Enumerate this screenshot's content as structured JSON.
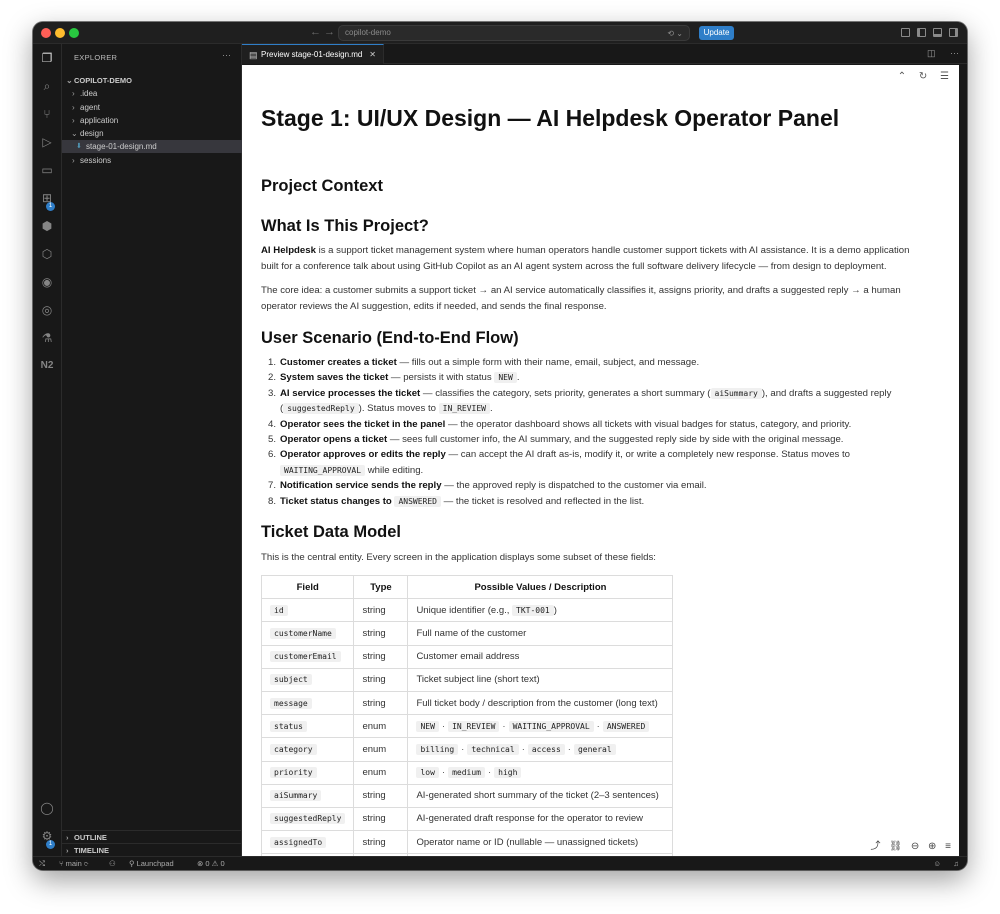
{
  "window": {
    "search_text": "copilot-demo",
    "update_label": "Update"
  },
  "activity_badges": {
    "extensions": "1",
    "accounts": "1"
  },
  "explorer": {
    "title": "EXPLORER",
    "root": "COPILOT-DEMO",
    "items": [
      ".idea",
      "agent",
      "application",
      "design",
      "stage-01-design.md",
      "sessions"
    ],
    "outline": "OUTLINE",
    "timeline": "TIMELINE"
  },
  "tab": {
    "label": "Preview stage-01-design.md"
  },
  "doc": {
    "h1": "Stage 1: UI/UX Design — AI Helpdesk Operator Panel",
    "h2_context": "Project Context",
    "h2_what": "What Is This Project?",
    "p1_bold": "AI Helpdesk",
    "p1_l1": " is a support ticket management system where human operators handle customer support tickets with AI assistance. It is a demo application",
    "p1_l2": "built for a conference talk about using GitHub Copilot as an AI agent system across the full software delivery lifecycle — from design to deployment.",
    "p2_l1": "The core idea: a customer submits a support ticket → an AI service automatically classifies it, assigns priority, and drafts a suggested reply → a human",
    "p2_l2": "operator reviews the AI suggestion, edits if needed, and sends the final response.",
    "h2_scenario": "User Scenario (End-to-End Flow)",
    "s1_b": "Customer creates a ticket",
    "s1_t": " — fills out a simple form with their name, email, subject, and message.",
    "s2_b": "System saves the ticket",
    "s2_t": " — persists it with status ",
    "s2_c": "NEW",
    "s2_e": ".",
    "s3_b": "AI service processes the ticket",
    "s3_t": " — classifies the category, sets priority, generates a short summary (",
    "s3_c1": "aiSummary",
    "s3_t2": "), and drafts a suggested reply",
    "s3_t3": "(",
    "s3_c2": "suggestedReply",
    "s3_t4": "). Status moves to ",
    "s3_c3": "IN_REVIEW",
    "s3_e": ".",
    "s4_b": "Operator sees the ticket in the panel",
    "s4_t": " — the operator dashboard shows all tickets with visual badges for status, category, and priority.",
    "s5_b": "Operator opens a ticket",
    "s5_t": " — sees full customer info, the AI summary, and the suggested reply side by side with the original message.",
    "s6_b": "Operator approves or edits the reply",
    "s6_t": " — can accept the AI draft as-is, modify it, or write a completely new response. Status moves to",
    "s6_c": "WAITING_APPROVAL",
    "s6_t2": " while editing.",
    "s7_b": "Notification service sends the reply",
    "s7_t": " — the approved reply is dispatched to the customer via email.",
    "s8_b": "Ticket status changes to ",
    "s8_c": "ANSWERED",
    "s8_t": " — the ticket is resolved and reflected in the list.",
    "h2_model": "Ticket Data Model",
    "p3": "This is the central entity. Every screen in the application displays some subset of these fields:",
    "table_headers": [
      "Field",
      "Type",
      "Possible Values / Description"
    ],
    "rows": [
      {
        "field": "id",
        "type": "string",
        "desc": "Unique identifier (e.g., ",
        "desc_code": "TKT-001",
        "desc_end": ")"
      },
      {
        "field": "customerName",
        "type": "string",
        "desc": "Full name of the customer"
      },
      {
        "field": "customerEmail",
        "type": "string",
        "desc": "Customer email address"
      },
      {
        "field": "subject",
        "type": "string",
        "desc": "Ticket subject line (short text)"
      },
      {
        "field": "message",
        "type": "string",
        "desc": "Full ticket body / description from the customer (long text)"
      },
      {
        "field": "status",
        "type": "enum",
        "codes": [
          "NEW",
          "IN_REVIEW",
          "WAITING_APPROVAL",
          "ANSWERED"
        ]
      },
      {
        "field": "category",
        "type": "enum",
        "codes": [
          "billing",
          "technical",
          "access",
          "general"
        ]
      },
      {
        "field": "priority",
        "type": "enum",
        "codes": [
          "low",
          "medium",
          "high"
        ]
      },
      {
        "field": "aiSummary",
        "type": "string",
        "desc": "AI-generated short summary of the ticket (2–3 sentences)"
      },
      {
        "field": "suggestedReply",
        "type": "string",
        "desc": "AI-generated draft response for the operator to review"
      },
      {
        "field": "assignedTo",
        "type": "string",
        "desc": "Operator name or ID (nullable — unassigned tickets)"
      }
    ],
    "sep": "·"
  },
  "status": {
    "branch": "main",
    "launchpad": "Launchpad",
    "errors": "0",
    "warnings": "0"
  }
}
